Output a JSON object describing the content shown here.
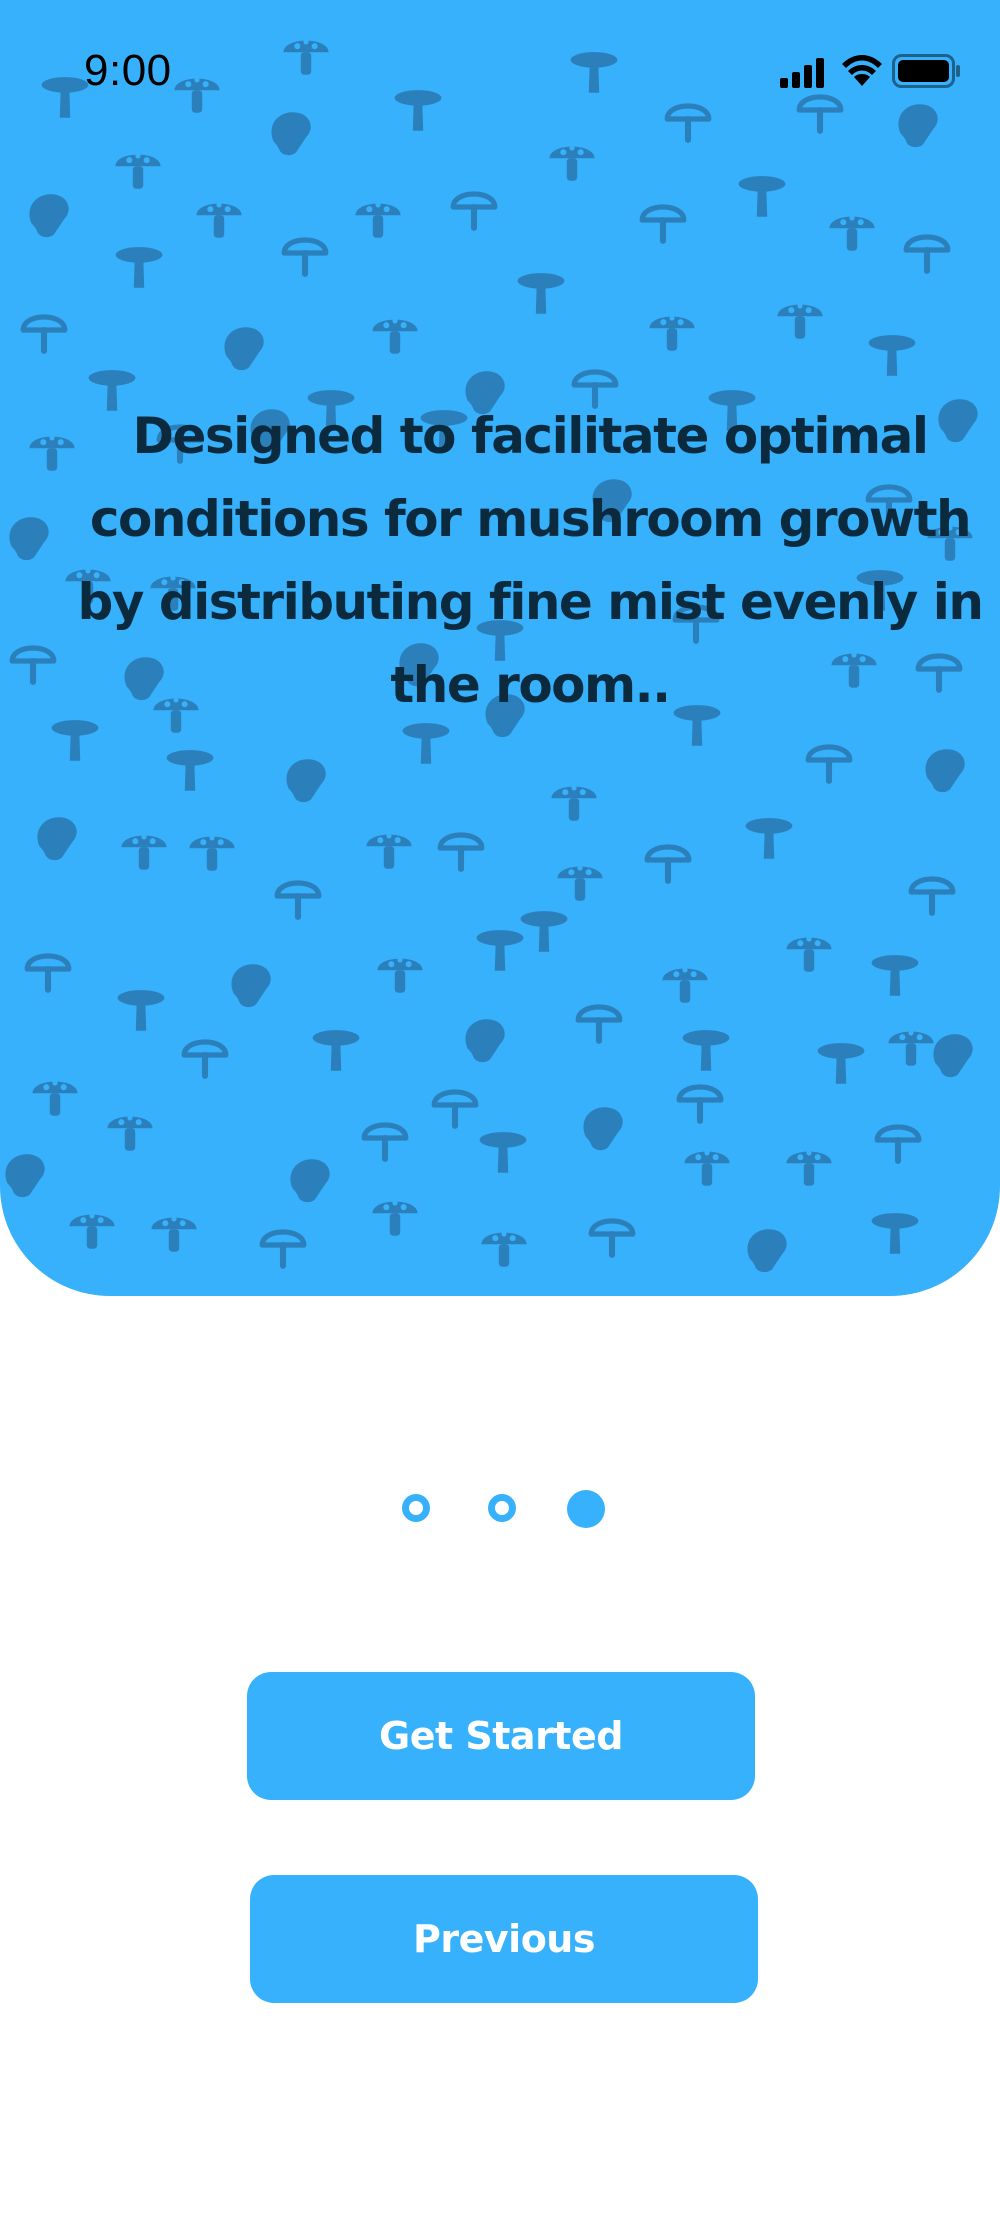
{
  "status_bar": {
    "time": "9:00",
    "icons": [
      "signal-icon",
      "wifi-icon",
      "battery-icon"
    ]
  },
  "hero": {
    "background_color": "#37b1fc",
    "pattern_icon": "mushroom-icon",
    "headline": "Designed to facilitate optimal conditions for mushroom growth by distributing fine mist evenly in the room.."
  },
  "pagination": {
    "total": 3,
    "current": 3
  },
  "buttons": {
    "primary_label": "Get Started",
    "secondary_label": "Previous"
  },
  "colors": {
    "accent": "#37b1fc",
    "pattern": "#2b7fbb",
    "headline": "#0c2a3e"
  }
}
